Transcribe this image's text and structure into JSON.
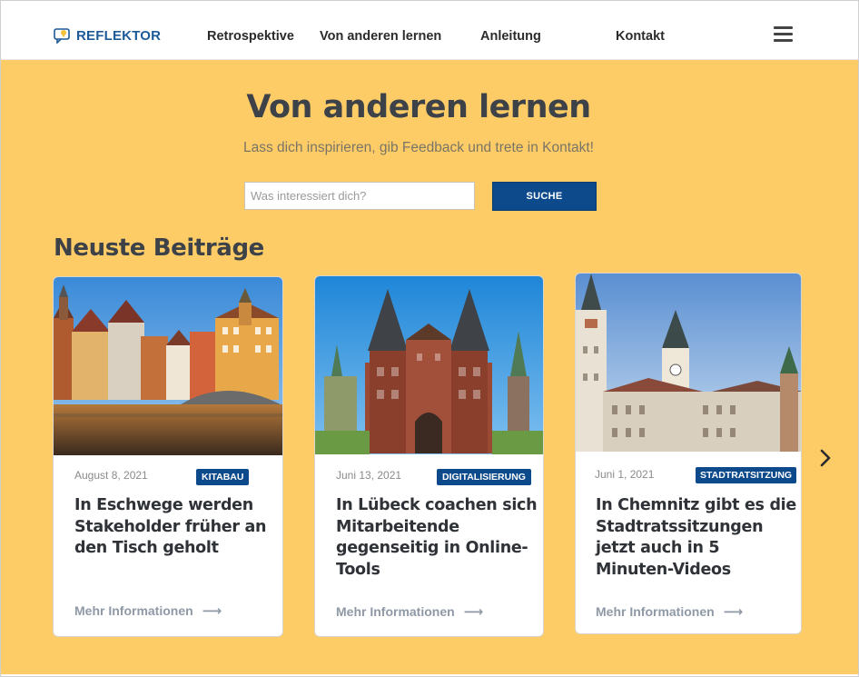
{
  "header": {
    "logo_text": "REFLEKTOR",
    "nav": [
      "Retrospektive",
      "Von anderen lernen",
      "Anleitung",
      "Kontakt"
    ]
  },
  "hero": {
    "title": "Von anderen lernen",
    "subtitle": "Lass dich inspirieren, gib Feedback und trete in Kontakt!",
    "search_placeholder": "Was interessiert dich?",
    "search_button": "SUCHE"
  },
  "section_title": "Neuste Beiträge",
  "cards": [
    {
      "date": "August 8, 2021",
      "tag": "KITABAU",
      "title": "In Eschwege werden Stakeholder früher an den Tisch geholt",
      "link": "Mehr Informationen"
    },
    {
      "date": "Juni 13, 2021",
      "tag": "DIGITALISIERUNG",
      "title": "In Lübeck coachen sich Mitarbeitende gegenseitig in Online-Tools",
      "link": "Mehr Informationen"
    },
    {
      "date": "Juni  1, 2021",
      "tag": "STADTRATSITZUNG",
      "title": "In Chemnitz gibt es die Stadtratssitzungen jetzt auch in 5 Minuten-Videos",
      "link": "Mehr Informationen"
    }
  ],
  "colors": {
    "accent": "#0d4a8c",
    "hero_bg": "#fdcc67",
    "text_dark": "#3d4148"
  },
  "icons": {
    "menu": "hamburger-menu-icon",
    "next": "chevron-right-icon",
    "arrow": "arrow-right-icon"
  }
}
